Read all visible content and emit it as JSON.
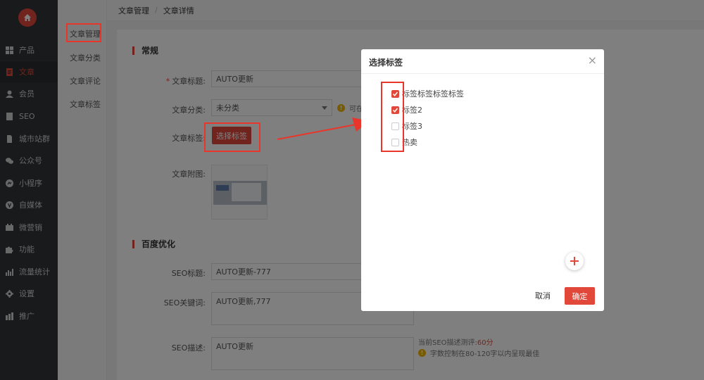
{
  "sidebar": {
    "items": [
      {
        "label": "产品",
        "icon": "grid-icon"
      },
      {
        "label": "文章",
        "icon": "document-icon",
        "active": true
      },
      {
        "label": "会员",
        "icon": "user-icon"
      },
      {
        "label": "SEO",
        "icon": "seo-icon"
      },
      {
        "label": "城市站群",
        "icon": "city-icon"
      },
      {
        "label": "公众号",
        "icon": "wechat-icon"
      },
      {
        "label": "小程序",
        "icon": "mini-program-icon"
      },
      {
        "label": "自媒体",
        "icon": "media-icon"
      },
      {
        "label": "微营销",
        "icon": "marketing-icon"
      },
      {
        "label": "功能",
        "icon": "puzzle-icon"
      },
      {
        "label": "流量统计",
        "icon": "chart-icon"
      },
      {
        "label": "设置",
        "icon": "gear-icon"
      },
      {
        "label": "推广",
        "icon": "promo-icon"
      }
    ]
  },
  "submenu": {
    "items": [
      {
        "label": "文章管理",
        "active": true
      },
      {
        "label": "文章分类"
      },
      {
        "label": "文章评论"
      },
      {
        "label": "文章标签"
      }
    ]
  },
  "breadcrumb": {
    "parent": "文章管理",
    "separator": "/",
    "current": "文章详情"
  },
  "form": {
    "section_general": "常规",
    "title_label": "文章标题:",
    "title_value": "AUTO更新",
    "category_label": "文章分类:",
    "category_value": "未分类",
    "category_hint": "可在",
    "tag_label": "文章标签:",
    "tag_button": "选择标签",
    "attachment_label": "文章附图:",
    "section_seo": "百度优化",
    "seo_title_label": "SEO标题:",
    "seo_title_value": "AUTO更新-777",
    "seo_keywords_label": "SEO关键词:",
    "seo_keywords_value": "AUTO更新,777",
    "seo_desc_label": "SEO描述:",
    "seo_desc_value": "AUTO更新",
    "seo_score_text": "当前SEO描述测评:",
    "seo_score_value": "60分",
    "seo_tip": "字数控制在80-120字以内呈现最佳"
  },
  "modal": {
    "title": "选择标签",
    "close": "×",
    "tags": [
      {
        "label": "标签标签标签标签",
        "checked": true
      },
      {
        "label": "标签2",
        "checked": true
      },
      {
        "label": "标签3",
        "checked": false
      },
      {
        "label": "热卖",
        "checked": false
      }
    ],
    "cancel": "取消",
    "confirm": "确定"
  },
  "colors": {
    "accent": "#e2483a",
    "sidebar": "#323437",
    "warn": "#f0b400"
  }
}
